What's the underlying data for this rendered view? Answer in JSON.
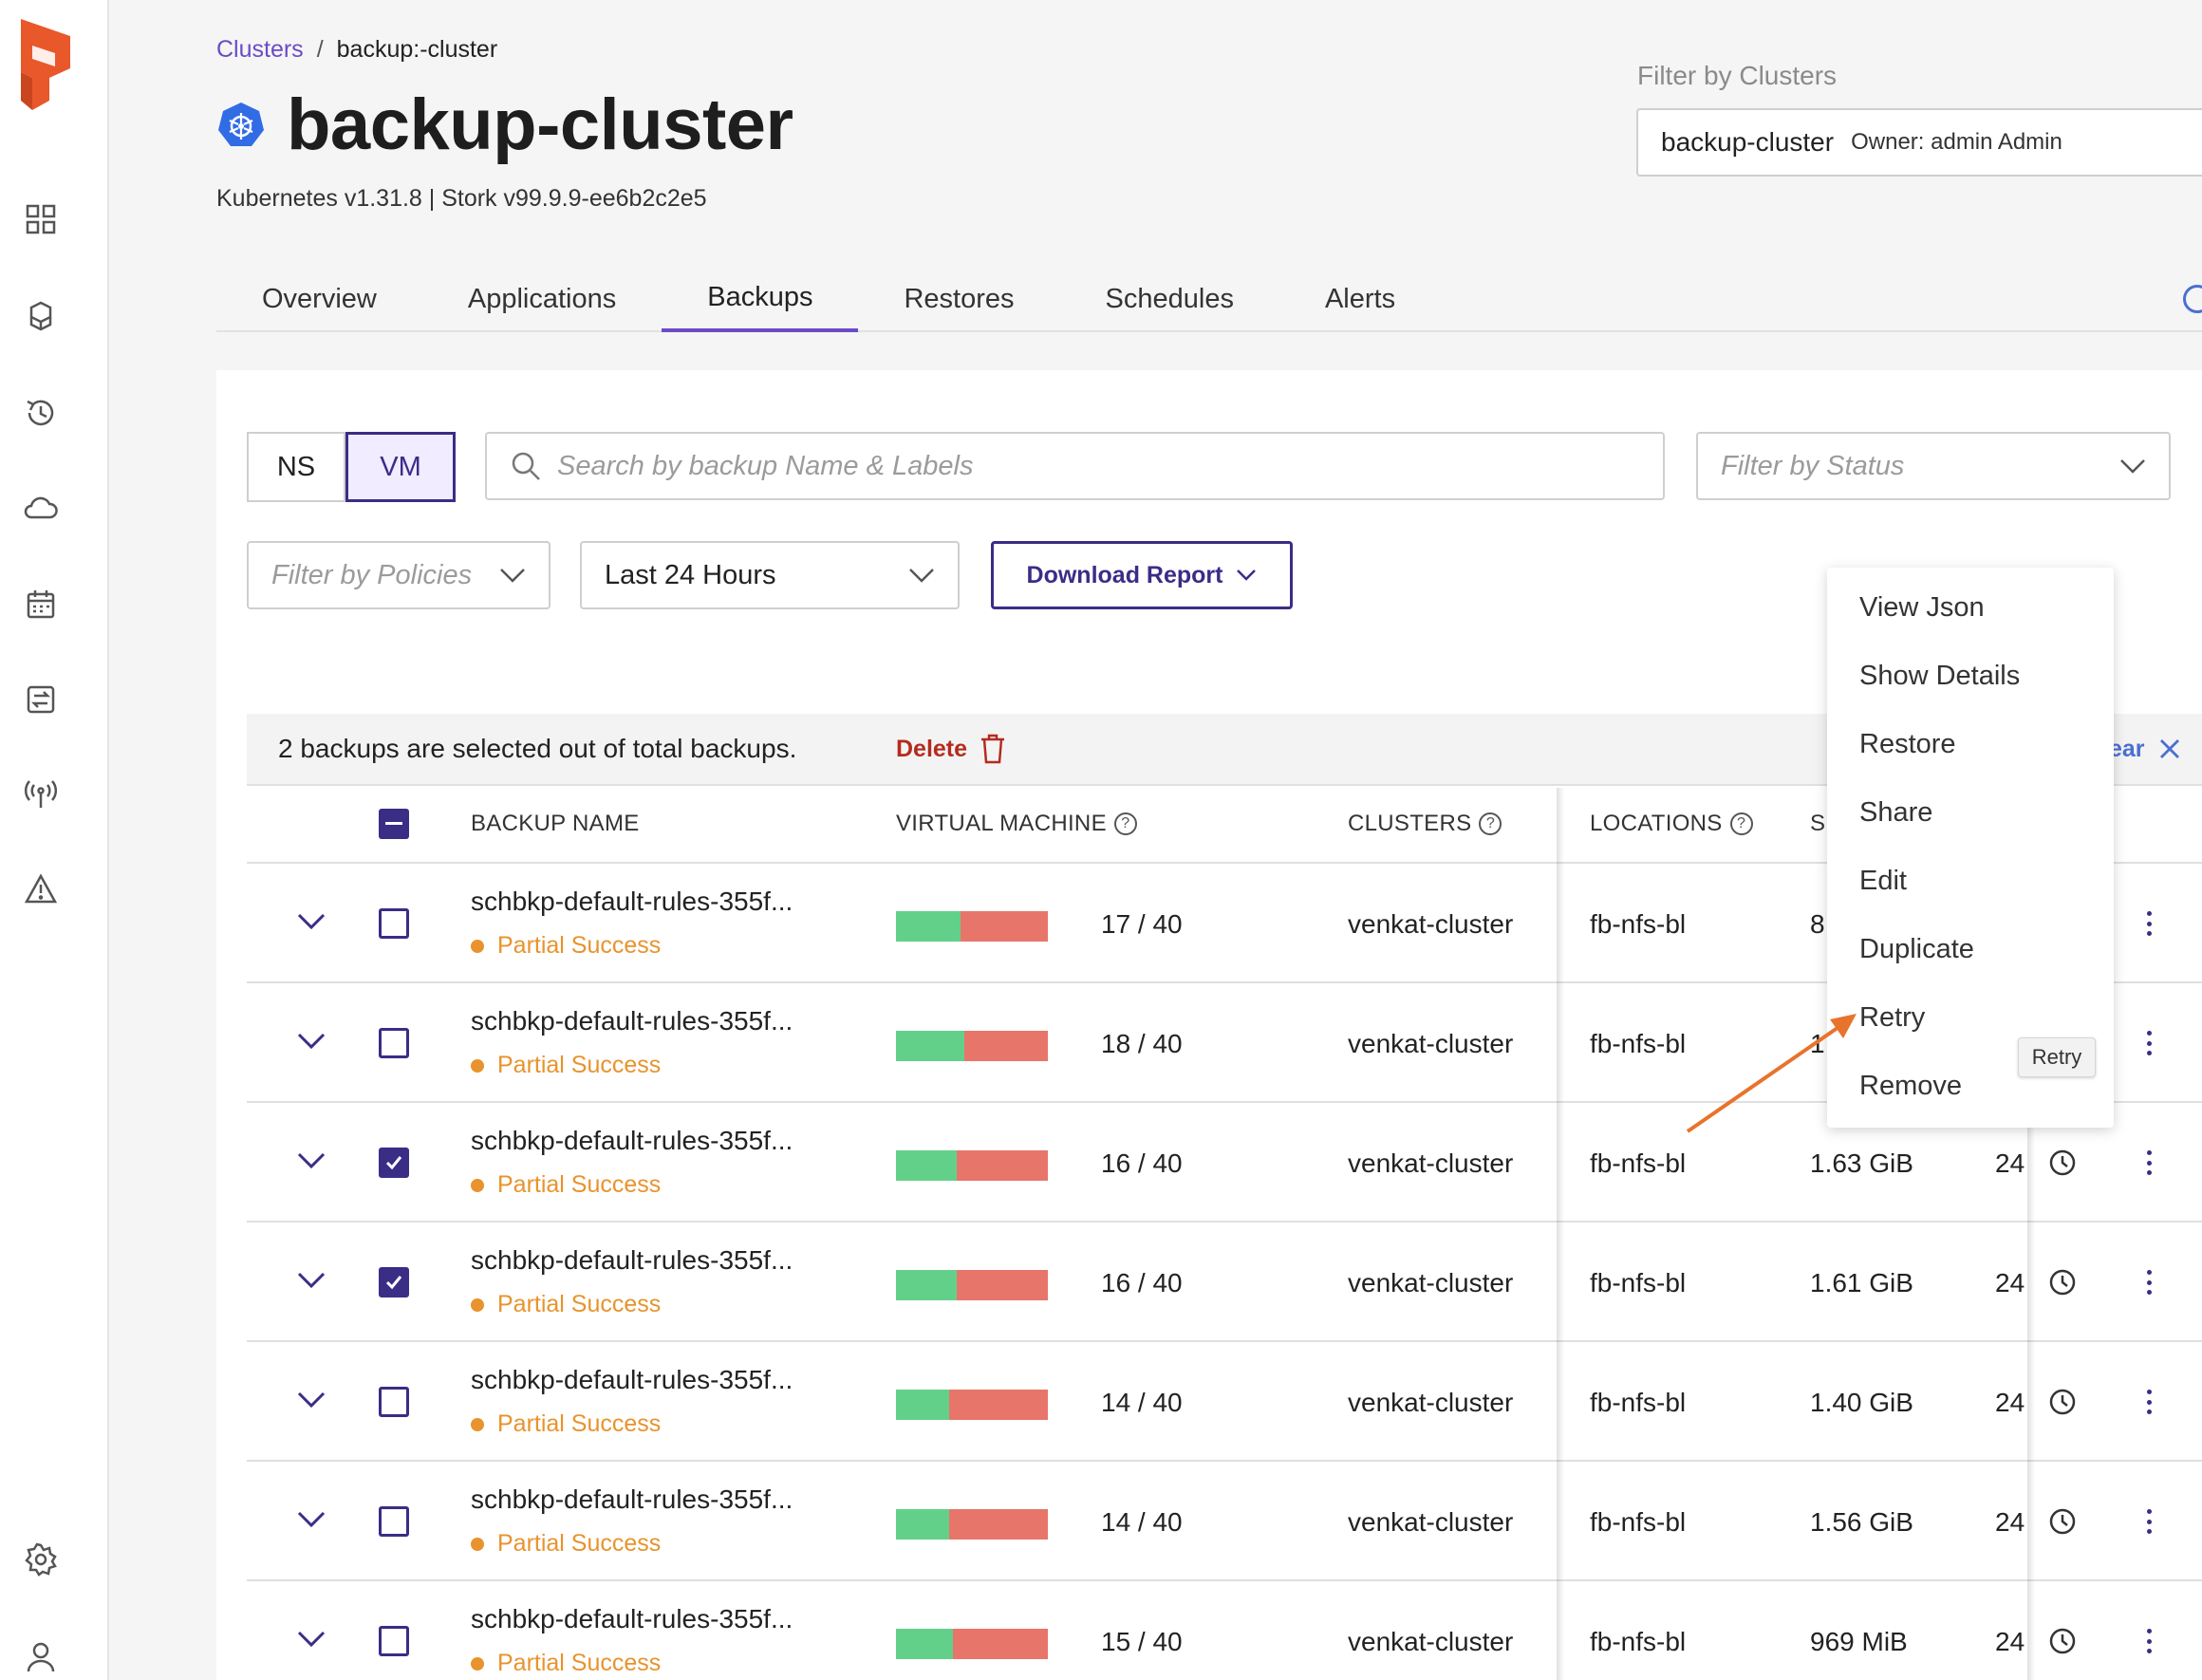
{
  "breadcrumb": {
    "link": "Clusters",
    "separator": "/",
    "current": "backup:-cluster"
  },
  "page": {
    "title": "backup-cluster",
    "subtitle": "Kubernetes v1.31.8 | Stork v99.9.9-ee6b2c2e5"
  },
  "cluster_filter": {
    "label": "Filter by Clusters",
    "name": "backup-cluster",
    "owner": "Owner: admin Admin"
  },
  "tabs": [
    "Overview",
    "Applications",
    "Backups",
    "Restores",
    "Schedules",
    "Alerts"
  ],
  "active_tab": "Backups",
  "toggle": {
    "ns": "NS",
    "vm": "VM",
    "active": "VM"
  },
  "search": {
    "placeholder": "Search by backup Name & Labels"
  },
  "filters": {
    "status_placeholder": "Filter by Status",
    "policies_placeholder": "Filter by Policies",
    "time_range": "Last 24 Hours",
    "download_label": "Download Report"
  },
  "selection_bar": {
    "text": "2 backups are selected out of total backups.",
    "delete_label": "Delete",
    "clear_label": "ear"
  },
  "table": {
    "headers": {
      "name": "BACKUP NAME",
      "vm": "VIRTUAL MACHINE",
      "clusters": "CLUSTERS",
      "locations": "LOCATIONS",
      "size": "SI"
    },
    "rows": [
      {
        "name": "schbkp-default-rules-355f...",
        "status": "Partial Success",
        "vm_done": 17,
        "vm_total": 40,
        "vm_text": "17 / 40",
        "cluster": "venkat-cluster",
        "location": "fb-nfs-bl",
        "size": "8",
        "time": "",
        "checked": false
      },
      {
        "name": "schbkp-default-rules-355f...",
        "status": "Partial Success",
        "vm_done": 18,
        "vm_total": 40,
        "vm_text": "18 / 40",
        "cluster": "venkat-cluster",
        "location": "fb-nfs-bl",
        "size": "1.",
        "time": "",
        "checked": false
      },
      {
        "name": "schbkp-default-rules-355f...",
        "status": "Partial Success",
        "vm_done": 16,
        "vm_total": 40,
        "vm_text": "16 / 40",
        "cluster": "venkat-cluster",
        "location": "fb-nfs-bl",
        "size": "1.63 GiB",
        "time": "24",
        "checked": true
      },
      {
        "name": "schbkp-default-rules-355f...",
        "status": "Partial Success",
        "vm_done": 16,
        "vm_total": 40,
        "vm_text": "16 / 40",
        "cluster": "venkat-cluster",
        "location": "fb-nfs-bl",
        "size": "1.61 GiB",
        "time": "24",
        "checked": true
      },
      {
        "name": "schbkp-default-rules-355f...",
        "status": "Partial Success",
        "vm_done": 14,
        "vm_total": 40,
        "vm_text": "14 / 40",
        "cluster": "venkat-cluster",
        "location": "fb-nfs-bl",
        "size": "1.40 GiB",
        "time": "24",
        "checked": false
      },
      {
        "name": "schbkp-default-rules-355f...",
        "status": "Partial Success",
        "vm_done": 14,
        "vm_total": 40,
        "vm_text": "14 / 40",
        "cluster": "venkat-cluster",
        "location": "fb-nfs-bl",
        "size": "1.56 GiB",
        "time": "24",
        "checked": false
      },
      {
        "name": "schbkp-default-rules-355f...",
        "status": "Partial Success",
        "vm_done": 15,
        "vm_total": 40,
        "vm_text": "15 / 40",
        "cluster": "venkat-cluster",
        "location": "fb-nfs-bl",
        "size": "969 MiB",
        "time": "24",
        "checked": false
      }
    ]
  },
  "context_menu": {
    "items": [
      "View Json",
      "Show Details",
      "Restore",
      "Share",
      "Edit",
      "Duplicate",
      "Retry",
      "Remove"
    ],
    "tooltip": "Retry"
  },
  "sidebar_icons": [
    "grid-icon",
    "cube-icon",
    "history-icon",
    "cloud-icon",
    "calendar-icon",
    "transfer-icon",
    "antenna-icon",
    "warning-icon",
    "settings-icon",
    "user-icon"
  ],
  "colors": {
    "accent": "#3a2d86",
    "link": "#6a4bc7",
    "partial": "#e8932d",
    "success_bar": "#63d08a",
    "fail_bar": "#e8756a",
    "danger": "#b42b1e",
    "logo": "#e8582a"
  }
}
